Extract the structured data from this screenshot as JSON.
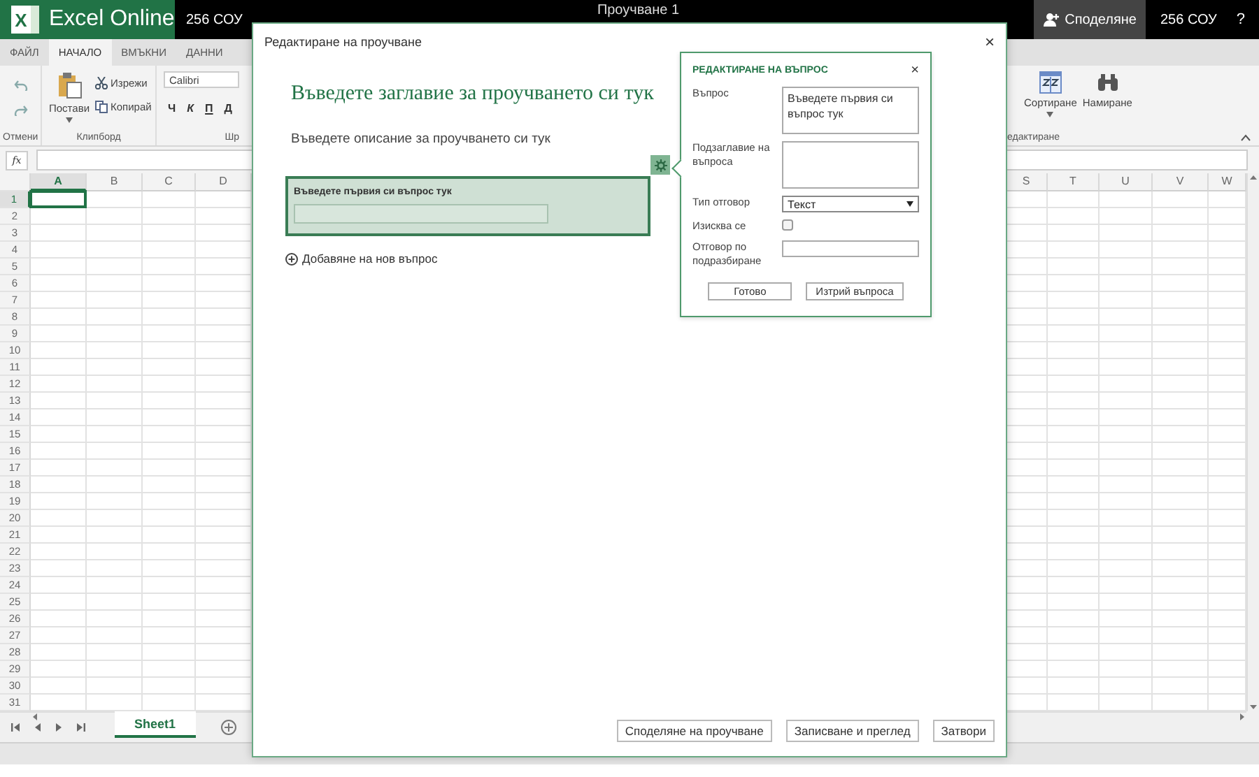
{
  "app": {
    "logo": "X",
    "brand": "Excel Online",
    "org": "256 СОУ",
    "document_title": "Проучване 1",
    "share": "Споделяне",
    "user": "256 СОУ",
    "help": "?"
  },
  "ribbon_tabs": [
    {
      "label": "ФАЙЛ",
      "selected": false
    },
    {
      "label": "НАЧАЛО",
      "selected": true
    },
    {
      "label": "ВМЪКНИ",
      "selected": false
    },
    {
      "label": "ДАННИ",
      "selected": false
    }
  ],
  "ribbon": {
    "undo_group": "Отмени",
    "paste": "Постави",
    "cut": "Изрежи",
    "copy": "Копирай",
    "clipboard_group": "Клипборд",
    "font": "Calibri",
    "font_group": "Шр",
    "sort": "Сортиране",
    "find": "Намиране",
    "editing_group": "едактиране",
    "format_buttons": [
      {
        "label": "Ч",
        "kind": "bold"
      },
      {
        "label": "К",
        "kind": "italic"
      },
      {
        "label": "П",
        "kind": "underline"
      },
      {
        "label": "Д",
        "kind": "double"
      }
    ]
  },
  "formula_bar": {
    "fx": "fx"
  },
  "grid": {
    "columns_left": [
      {
        "label": "A",
        "selected": true
      },
      {
        "label": "B",
        "selected": false
      },
      {
        "label": "C",
        "selected": false
      },
      {
        "label": "D",
        "selected": false
      }
    ],
    "columns_right": [
      {
        "label": "S",
        "selected": false
      },
      {
        "label": "T",
        "selected": false
      },
      {
        "label": "U",
        "selected": false
      },
      {
        "label": "V",
        "selected": false
      },
      {
        "label": "W",
        "selected": false
      }
    ],
    "rows": [
      {
        "label": "1",
        "selected": true
      },
      {
        "label": "2",
        "selected": false
      },
      {
        "label": "3",
        "selected": false
      },
      {
        "label": "4",
        "selected": false
      },
      {
        "label": "5",
        "selected": false
      },
      {
        "label": "6",
        "selected": false
      },
      {
        "label": "7",
        "selected": false
      },
      {
        "label": "8",
        "selected": false
      },
      {
        "label": "9",
        "selected": false
      },
      {
        "label": "10",
        "selected": false
      },
      {
        "label": "11",
        "selected": false
      },
      {
        "label": "12",
        "selected": false
      },
      {
        "label": "13",
        "selected": false
      },
      {
        "label": "14",
        "selected": false
      },
      {
        "label": "15",
        "selected": false
      },
      {
        "label": "16",
        "selected": false
      },
      {
        "label": "17",
        "selected": false
      },
      {
        "label": "18",
        "selected": false
      },
      {
        "label": "19",
        "selected": false
      },
      {
        "label": "20",
        "selected": false
      },
      {
        "label": "21",
        "selected": false
      },
      {
        "label": "22",
        "selected": false
      },
      {
        "label": "23",
        "selected": false
      },
      {
        "label": "24",
        "selected": false
      },
      {
        "label": "25",
        "selected": false
      },
      {
        "label": "26",
        "selected": false
      },
      {
        "label": "27",
        "selected": false
      },
      {
        "label": "28",
        "selected": false
      },
      {
        "label": "29",
        "selected": false
      },
      {
        "label": "30",
        "selected": false
      },
      {
        "label": "31",
        "selected": false
      }
    ]
  },
  "sheets": [
    {
      "label": "Sheet1",
      "selected": true
    }
  ],
  "dialog": {
    "title": "Редактиране на проучване",
    "close": "×",
    "survey_title": "Въведете заглавие за проучването си тук",
    "survey_description": "Въведете описание за проучването си тук",
    "questions": [
      {
        "title": "Въведете първия си въпрос тук",
        "selected": true
      }
    ],
    "add_question": "Добавяне на нов въпрос",
    "buttons": [
      "Споделяне на проучване",
      "Записване и преглед",
      "Затвори"
    ]
  },
  "question_editor": {
    "heading": "РЕДАКТИРАНЕ НА ВЪПРОС",
    "close": "×",
    "fields": [
      {
        "kind": "textarea",
        "label": "Въпрос",
        "value": "Въведете първия си въпрос тук"
      },
      {
        "kind": "textarea",
        "label": "Подзаглавие на въпроса"
      },
      {
        "kind": "select",
        "label": "Тип отговор",
        "value": "Текст"
      },
      {
        "kind": "checkbox",
        "label": "Изисква се",
        "checked": false
      },
      {
        "kind": "text",
        "label": "Отговор по подразбиране"
      }
    ],
    "buttons": [
      "Готово",
      "Изтрий въпроса"
    ]
  }
}
